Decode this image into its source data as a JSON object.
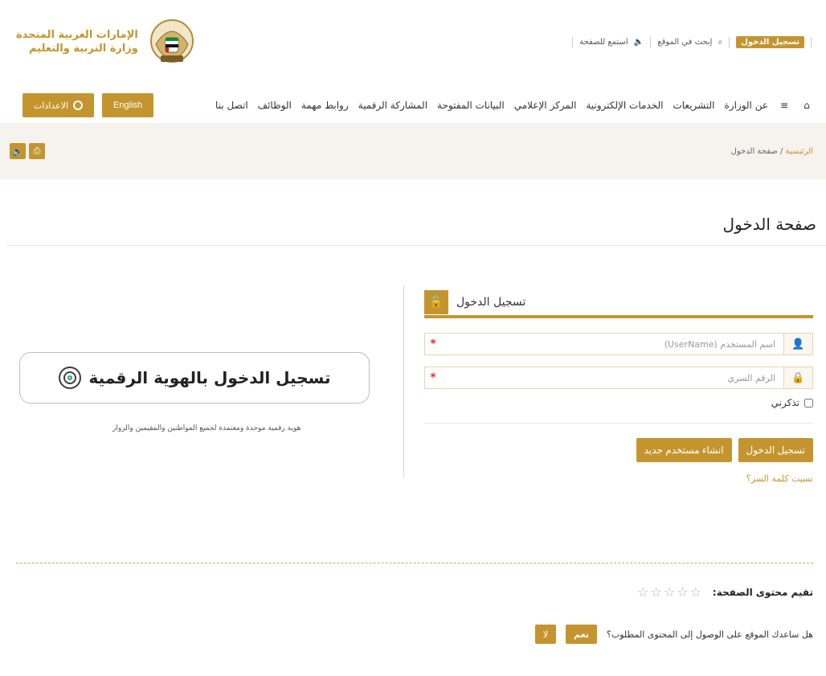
{
  "header": {
    "logo_line1": "الإمارات العربية المتحدة",
    "logo_line2": "وزارة التربية والتعليم",
    "top_links": {
      "login": "تسجيل الدخول",
      "search": "إبحث في الموقع",
      "listen": "استمع للصفحة"
    }
  },
  "nav": {
    "menu_items": [
      "عن الوزارة",
      "التشريعات",
      "الخدمات الإلكترونية",
      "المركز الإعلامي",
      "البيانات المفتوحة",
      "المشاركة الرقمية",
      "روابط مهمة",
      "الوظائف",
      "اتصل بنا"
    ],
    "settings_label": "الاعدادات",
    "language_label": "English"
  },
  "breadcrumb": {
    "home": "الرئيسية",
    "current": "صفحة الدخول"
  },
  "page": {
    "title": "صفحة الدخول"
  },
  "login": {
    "title": "تسجيل الدخول",
    "username_placeholder": "اسم المستخدم (UserName)",
    "password_placeholder": "الرقم السري",
    "remember_me": "تذكرني",
    "login_button": "تسجيل الدخول",
    "register_button": "انشاء مستخدم جديد",
    "forgot_password": "نسيت كلمة السر؟"
  },
  "uae_pass": {
    "label": "تسجيل الدخول بالهوية الرقمية",
    "caption": "هوية رقمية موحدة ومعتمدة لجميع المواطنين والمقيمين والزوار"
  },
  "feedback": {
    "rating_label": "تقيم محتوى الصفحة:",
    "helpful_question": "هل ساعدك الموقع على الوصول إلى المحتوى المطلوب؟",
    "yes": "نعم",
    "no": "لا"
  },
  "theme": {
    "accent": "#c4952f"
  }
}
